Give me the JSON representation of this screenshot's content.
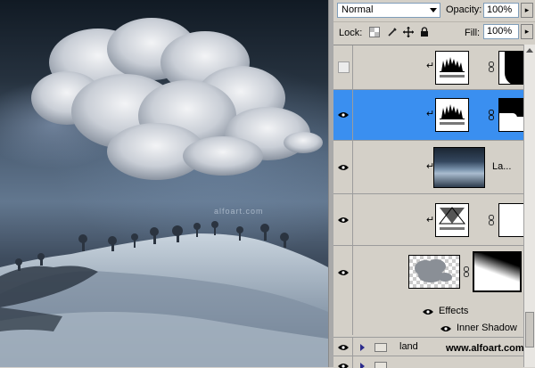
{
  "canvas": {
    "watermark": "alfoart.com"
  },
  "toolbar": {
    "blend_mode": "Normal",
    "opacity_label": "Opacity:",
    "opacity_value": "100%",
    "lock_label": "Lock:",
    "fill_label": "Fill:",
    "fill_value": "100%"
  },
  "layers": [
    {
      "visible": false,
      "type": "levels-adjustment",
      "clipped": true,
      "has_mask": true,
      "selected": false
    },
    {
      "visible": true,
      "type": "levels-adjustment",
      "clipped": true,
      "has_mask": true,
      "selected": true
    },
    {
      "visible": true,
      "type": "image",
      "name": "La...",
      "clipped": true,
      "selected": false
    },
    {
      "visible": true,
      "type": "gradient-map-adjustment",
      "clipped": true,
      "has_mask": true,
      "selected": false
    },
    {
      "visible": true,
      "type": "cloud-image",
      "has_mask": true,
      "selected": false
    }
  ],
  "effects": {
    "label": "Effects",
    "item": "Inner Shadow"
  },
  "groups": [
    {
      "name": "land",
      "visible": true,
      "expanded": false
    }
  ],
  "footer": {
    "credit": "www.alfoart.com"
  },
  "colors": {
    "selection": "#3a8ff0",
    "panel": "#d4d0c8"
  }
}
